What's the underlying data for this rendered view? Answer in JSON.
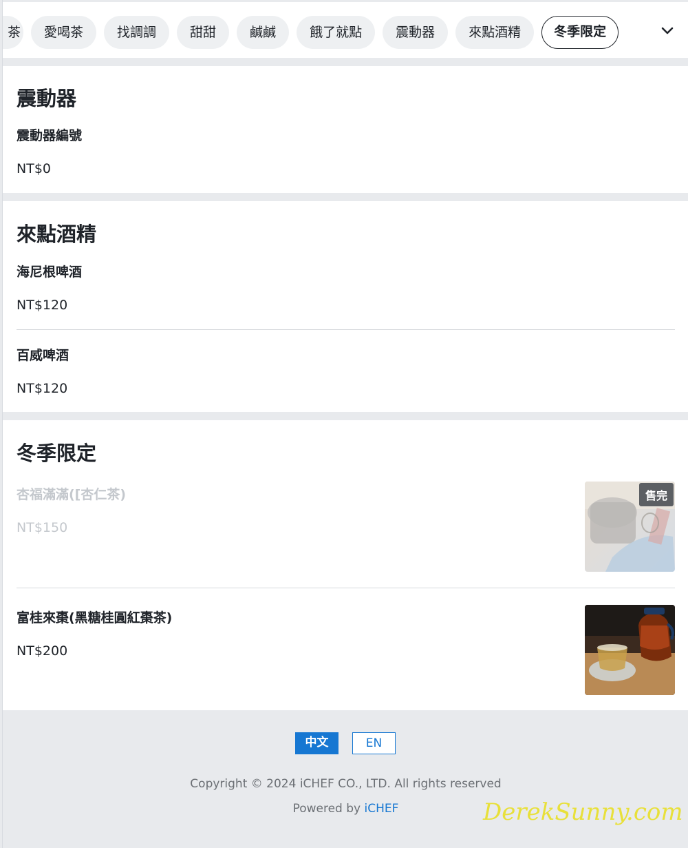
{
  "categories": {
    "partial_label": "茶",
    "items": [
      "愛喝茶",
      "找調調",
      "甜甜",
      "鹹鹹",
      "餓了就點",
      "震動器",
      "來點酒精",
      "冬季限定"
    ],
    "active": "冬季限定",
    "expand_icon": "chevron-down-icon"
  },
  "sections": [
    {
      "title": "震動器",
      "items": [
        {
          "name": "震動器編號",
          "price": "NT$0"
        }
      ]
    },
    {
      "title": "來點酒精",
      "items": [
        {
          "name": "海尼根啤酒",
          "price": "NT$120"
        },
        {
          "name": "百威啤酒",
          "price": "NT$120"
        }
      ]
    },
    {
      "title": "冬季限定",
      "items": [
        {
          "name": "杏福滿滿([杏仁茶)",
          "price": "NT$150",
          "sold_out": true,
          "badge": "售完"
        },
        {
          "name": "富桂來棗(黑糖桂圓紅棗茶)",
          "price": "NT$200",
          "sold_out": false
        }
      ]
    }
  ],
  "footer": {
    "lang_zh": "中文",
    "lang_en": "EN",
    "copyright": "Copyright © 2024 iCHEF CO., LTD. All rights reserved",
    "powered_prefix": "Powered by ",
    "powered_brand": "iCHEF",
    "watermark": "DerekSunny.com"
  },
  "colors": {
    "accent": "#1677d2",
    "sold_out_text": "#c4c8cd",
    "badge_bg": "#5c5f63",
    "page_bg": "#e8eaed"
  }
}
